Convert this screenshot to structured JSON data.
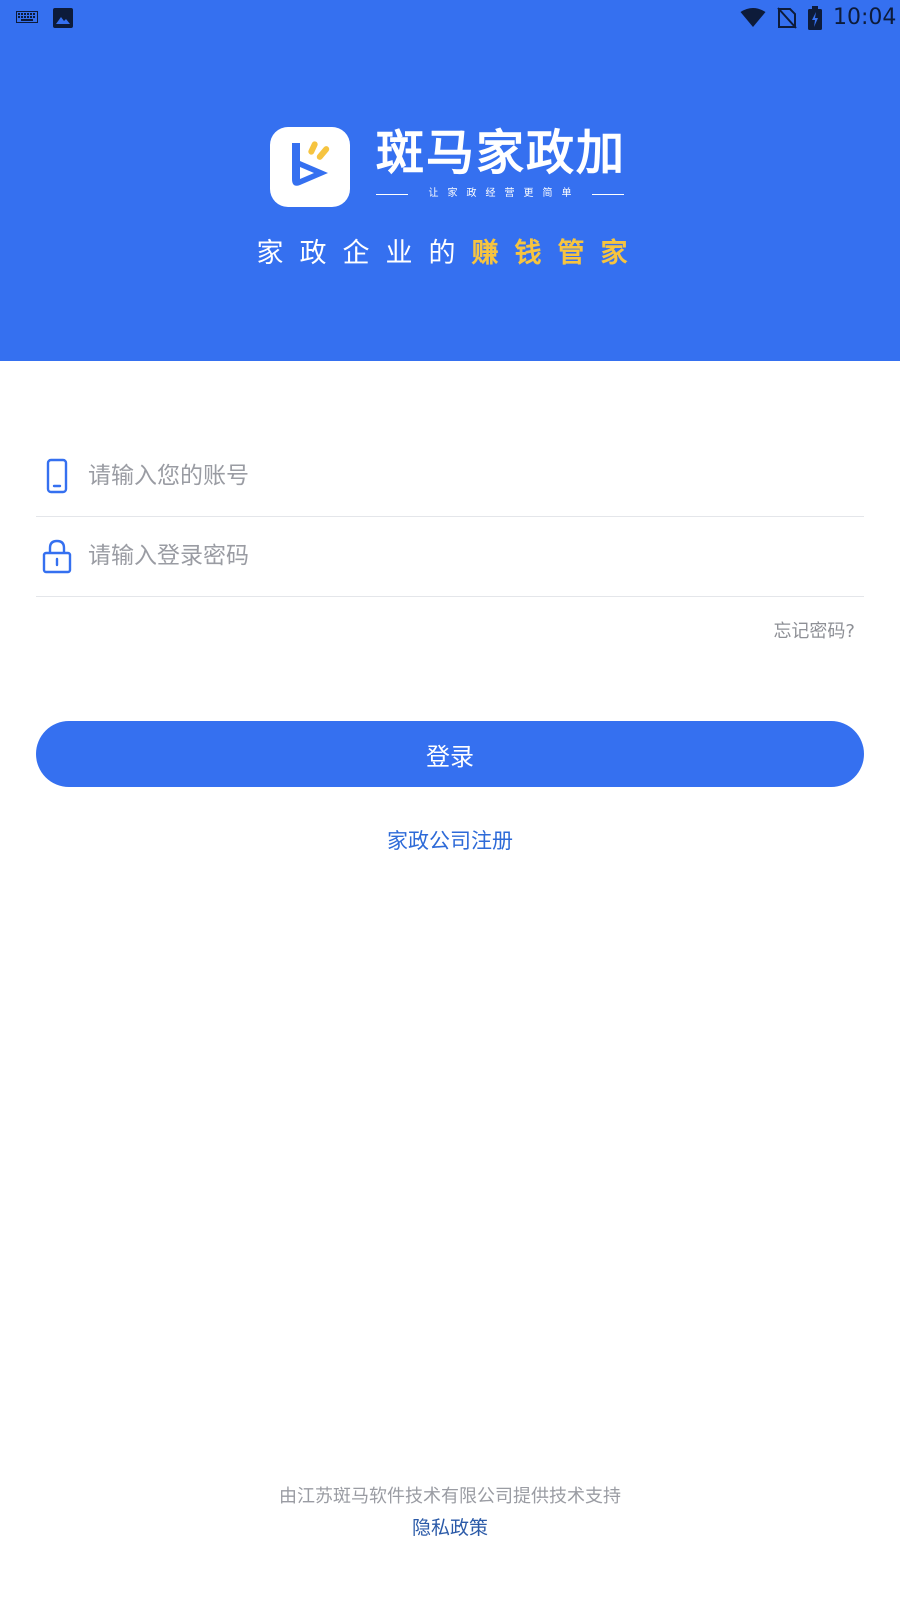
{
  "status_bar": {
    "time": "10:04",
    "icons": [
      "keyboard-icon",
      "image-icon",
      "wifi-icon",
      "no-sim-icon",
      "battery-charging-icon"
    ]
  },
  "brand": {
    "name": "斑马家政加",
    "tagline": "让家政经营更简单",
    "logo_icon": "zebra-app-logo-icon"
  },
  "slogan": {
    "prefix": "家政企业的",
    "highlight": "赚钱管家"
  },
  "form": {
    "account_placeholder": "请输入您的账号",
    "account_icon": "phone-icon",
    "password_placeholder": "请输入登录密码",
    "password_icon": "lock-icon",
    "forgot_label": "忘记密码?",
    "login_label": "登录",
    "register_label": "家政公司注册"
  },
  "footer": {
    "support_text": "由江苏斑马软件技术有限公司提供技术支持",
    "privacy_label": "隐私政策"
  },
  "colors": {
    "primary": "#3570f0",
    "highlight": "#f6c440",
    "link": "#2d6ad8",
    "muted": "#9a9ca3"
  }
}
